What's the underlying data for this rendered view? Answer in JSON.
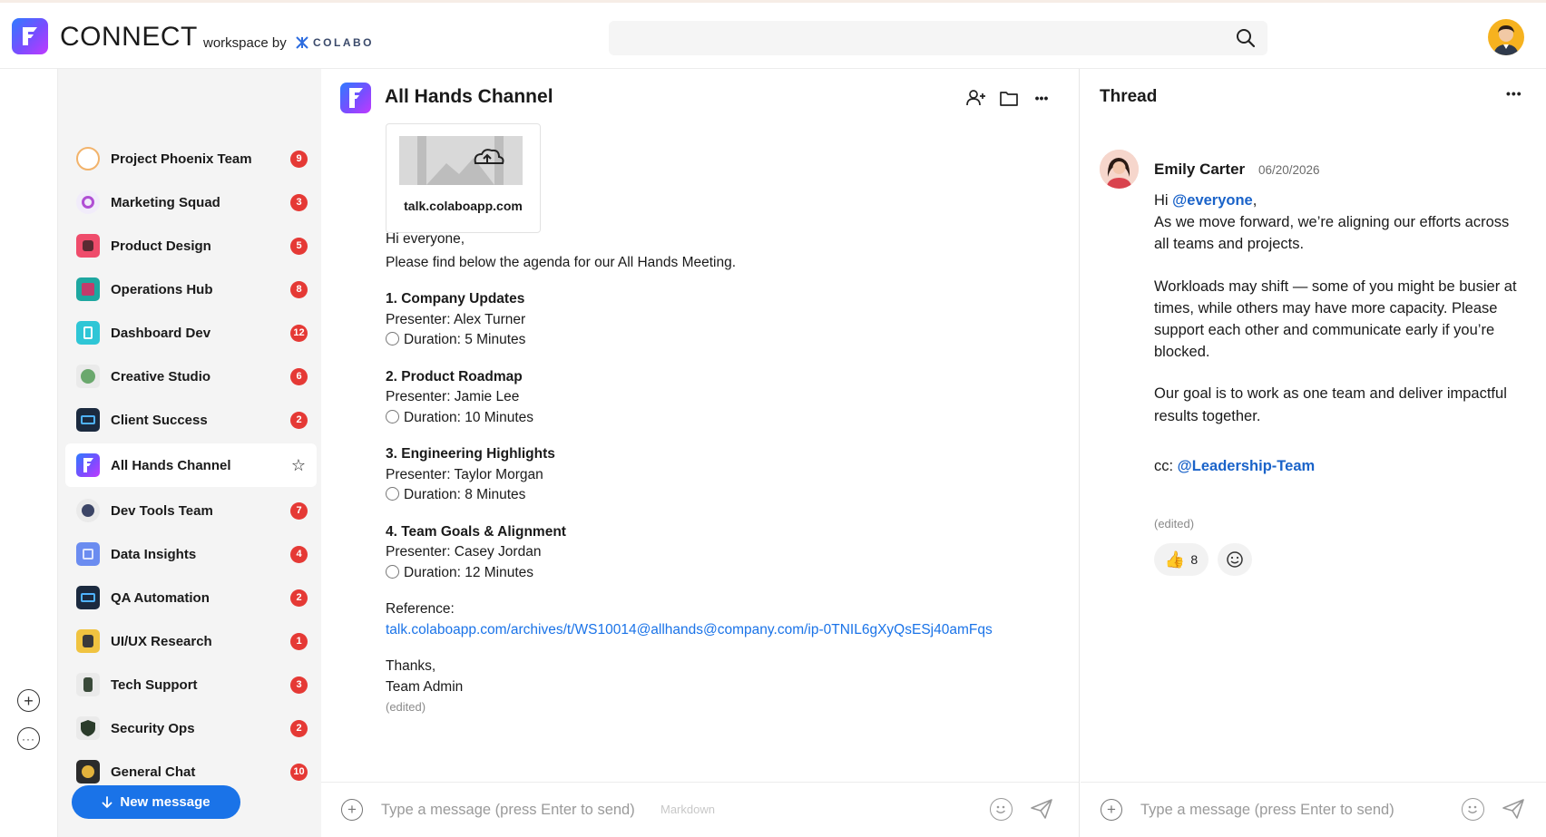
{
  "header": {
    "brand": "CONNECT",
    "workspace_by": "workspace by",
    "partner": "COLABO",
    "search_placeholder": ""
  },
  "sidebar": {
    "channels": [
      {
        "name": "Project Phoenix Team",
        "badge": "9",
        "icon_color": "#f6e7c8"
      },
      {
        "name": "Marketing Squad",
        "badge": "3",
        "icon_color": "#e9e1f5"
      },
      {
        "name": "Product Design",
        "badge": "5",
        "icon_color": "#ef4c6b"
      },
      {
        "name": "Operations Hub",
        "badge": "8",
        "icon_color": "#1ea7a0"
      },
      {
        "name": "Dashboard Dev",
        "badge": "12",
        "icon_color": "#2fc6d6"
      },
      {
        "name": "Creative Studio",
        "badge": "6",
        "icon_color": "#6aa86d"
      },
      {
        "name": "Client Success",
        "badge": "2",
        "icon_color": "#1b2a3f"
      },
      {
        "name": "All Hands Channel",
        "badge": "",
        "icon_color": "#7a4dff",
        "active": true
      },
      {
        "name": "Dev Tools Team",
        "badge": "7",
        "icon_color": "#3c4566"
      },
      {
        "name": "Data Insights",
        "badge": "4",
        "icon_color": "#6b8cf0"
      },
      {
        "name": "QA Automation",
        "badge": "2",
        "icon_color": "#1b2a3f"
      },
      {
        "name": "UI/UX Research",
        "badge": "1",
        "icon_color": "#f0c340"
      },
      {
        "name": "Tech Support",
        "badge": "3",
        "icon_color": "#3a4a3a"
      },
      {
        "name": "Security Ops",
        "badge": "2",
        "icon_color": "#2a3b2a"
      },
      {
        "name": "General Chat",
        "badge": "10",
        "icon_color": "#2b2b2b"
      }
    ],
    "new_message_label": "New message"
  },
  "main": {
    "title": "All Hands Channel",
    "preview_label": "talk.colaboapp.com",
    "greeting": "Hi everyone,",
    "intro": "Please find below the agenda for our All Hands Meeting.",
    "agenda": [
      {
        "title": "1. Company Updates",
        "presenter": "Presenter: Alex Turner",
        "duration": "Duration: 5 Minutes"
      },
      {
        "title": "2. Product Roadmap",
        "presenter": "Presenter: Jamie Lee",
        "duration": "Duration: 10 Minutes"
      },
      {
        "title": "3. Engineering Highlights",
        "presenter": "Presenter: Taylor Morgan",
        "duration": "Duration: 8 Minutes"
      },
      {
        "title": "4. Team Goals & Alignment",
        "presenter": "Presenter: Casey Jordan",
        "duration": "Duration: 12 Minutes"
      }
    ],
    "reference_label": "Reference:",
    "reference_link": "talk.colaboapp.com/archives/t/WS10014@allhands@company.com/ip-0TNIL6gXyQsESj40amFqs",
    "thanks": "Thanks,",
    "signature": "Team Admin",
    "edited": "(edited)",
    "composer_placeholder": "Type a message (press Enter to send)",
    "composer_hint": "Markdown"
  },
  "thread": {
    "title": "Thread",
    "author": "Emily Carter",
    "date": "06/20/2026",
    "hi": "Hi ",
    "mention_everyone": "@everyone",
    "comma": ",",
    "p1": "As we move forward, we’re aligning our efforts across all teams and projects.",
    "p2": "Workloads may shift — some of you might be busier at times, while others may have more capacity. Please support each other and communicate early if you’re blocked.",
    "p3": "Our goal is to work as one team and deliver impactful results together.",
    "cc": "cc: ",
    "mention_team": "@Leadership-Team",
    "edited": "(edited)",
    "reaction_emoji": "👍",
    "reaction_count": "8",
    "composer_placeholder": "Type a message (press Enter to send)"
  },
  "colors": {
    "accent": "#1a73e8",
    "badge": "#e53935",
    "mention": "#1a63c9"
  }
}
